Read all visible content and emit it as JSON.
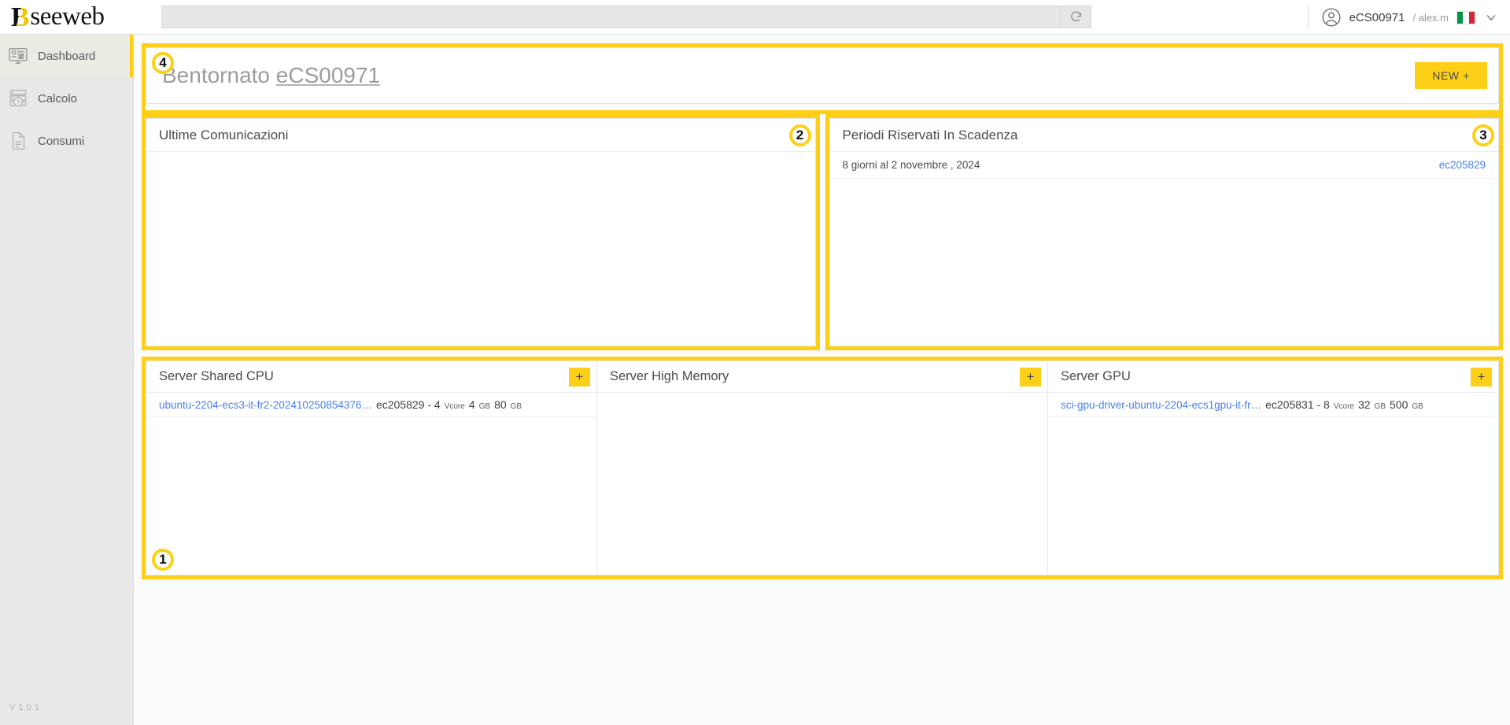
{
  "brand": {
    "mark": "B",
    "name": "seeweb"
  },
  "topbar": {
    "search_value": "",
    "search_placeholder": "",
    "refresh_icon": "refresh-icon",
    "account": "eCS00971",
    "username": "/ alex.m",
    "flag": "italy-flag-icon",
    "chevron": "chevron-down-icon"
  },
  "sidebar": {
    "items": [
      {
        "label": "Dashboard",
        "icon": "dashboard-icon",
        "active": true
      },
      {
        "label": "Calcolo",
        "icon": "server-clock-icon",
        "active": false
      },
      {
        "label": "Consumi",
        "icon": "document-icon",
        "active": false
      }
    ],
    "version": "V 1.0.1"
  },
  "welcome": {
    "greeting": "Bentornato ",
    "account": "eCS00971",
    "new_button": "NEW +",
    "badge": "4"
  },
  "communications": {
    "title": "Ultime Comunicazioni",
    "badge": "2",
    "rows": []
  },
  "reserved_periods": {
    "title": "Periodi Riservati In Scadenza",
    "badge": "3",
    "rows": [
      {
        "text": "8 giorni al 2 novembre , 2024",
        "link": "ec205829"
      }
    ]
  },
  "servers": {
    "badge": "1",
    "cards": [
      {
        "title": "Server Shared CPU",
        "add_label": "+",
        "rows": [
          {
            "name": "ubuntu-2204-ecs3-it-fr2-202410250854376…",
            "id": "ec205829 - 4",
            "vcore_unit": "Vcore",
            "ram": "4",
            "ram_unit": "GB",
            "disk": "80",
            "disk_unit": "GB"
          }
        ]
      },
      {
        "title": "Server High Memory",
        "add_label": "+",
        "rows": []
      },
      {
        "title": "Server GPU",
        "add_label": "+",
        "rows": [
          {
            "name": "sci-gpu-driver-ubuntu-2204-ecs1gpu-it-fr…",
            "id": "ec205831 - 8",
            "vcore_unit": "Vcore",
            "ram": "32",
            "ram_unit": "GB",
            "disk": "500",
            "disk_unit": "GB"
          }
        ]
      }
    ]
  },
  "colors": {
    "accent_yellow": "#fdd017",
    "link_blue": "#4a7ff0",
    "sidebar_bg": "#e8e8e8"
  }
}
